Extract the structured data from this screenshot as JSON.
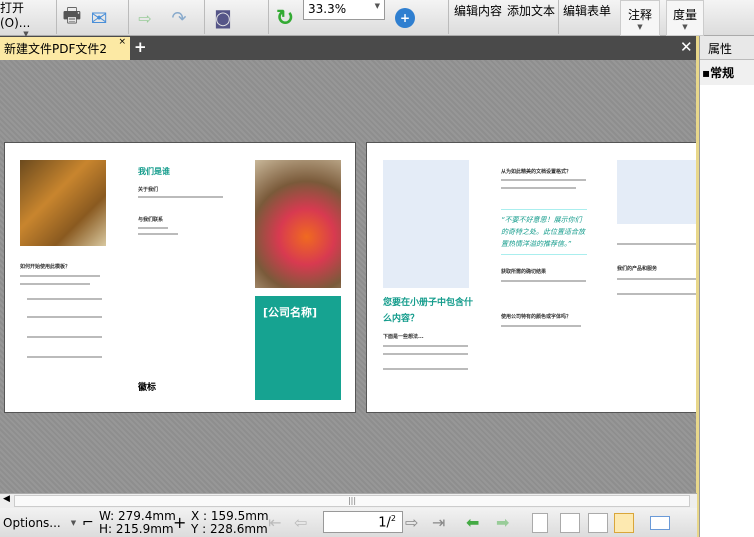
{
  "toolbar": {
    "open": "打开(O)...",
    "zoom": "33.3%",
    "edit_content": "编辑内容",
    "add_text": "添加文本",
    "edit_form": "编辑表单",
    "annotate": "注释",
    "measure": "度量"
  },
  "tabs": [
    {
      "label": "新建文件PDF文件2",
      "close": "×"
    }
  ],
  "right_panel": {
    "title": "属性",
    "section": "常规"
  },
  "page1": {
    "who_title": "我们是谁",
    "about": "关于我们",
    "contact": "与我们联系",
    "how_title": "如何开始使用此模板？",
    "company": "[公司名称]",
    "logo_label": "徽标"
  },
  "page2": {
    "q_title": "您要在小册子中包含什么内容？",
    "sub1": "下面是一些想法...",
    "h1": "从为如此精美的文档设置格式？",
    "quote": "“不要不好意思！展示你们的奇特之处。此位置适合放置热情洋溢的推荐信。”",
    "h2": "获取所需的确切结果",
    "h3": "使用公司特有的颜色或字体吗？",
    "h4": "我们的产品和服务"
  },
  "status": {
    "options": "Options...",
    "w": "W: 279.4mm",
    "h": "H: 215.9mm",
    "x": "X : 159.5mm",
    "y": "Y : 228.6mm",
    "page_current": "1",
    "page_total": "2"
  }
}
